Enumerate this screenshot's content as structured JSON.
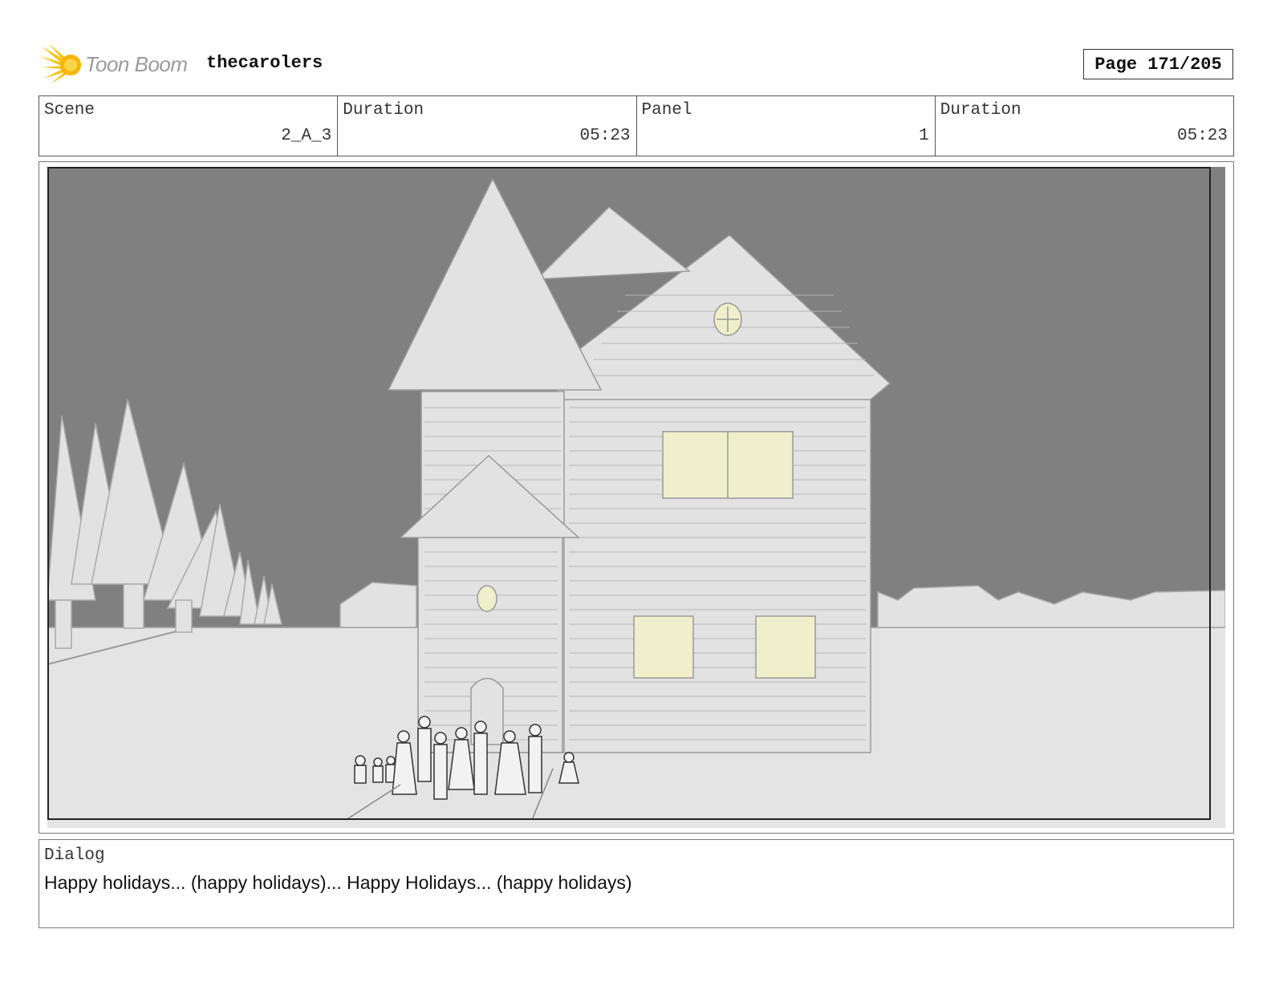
{
  "header": {
    "logo_text": "Toon Boom",
    "project_name": "thecarolers",
    "page_label": "Page 171/205"
  },
  "info": {
    "scene_label": "Scene",
    "scene_value": "2_A_3",
    "scene_duration_label": "Duration",
    "scene_duration_value": "05:23",
    "panel_label": "Panel",
    "panel_value": "1",
    "panel_duration_label": "Duration",
    "panel_duration_value": "05:23"
  },
  "dialog": {
    "label": "Dialog",
    "text": "Happy holidays... (happy holidays)... Happy Holidays... (happy holidays)"
  },
  "colors": {
    "sky": "#808080",
    "ground": "#e4e4e4",
    "house": "#e2e2e2",
    "window_glow": "#efefcc",
    "line": "#999999"
  },
  "icons": {
    "logo": "toon-boom-sun-icon"
  }
}
